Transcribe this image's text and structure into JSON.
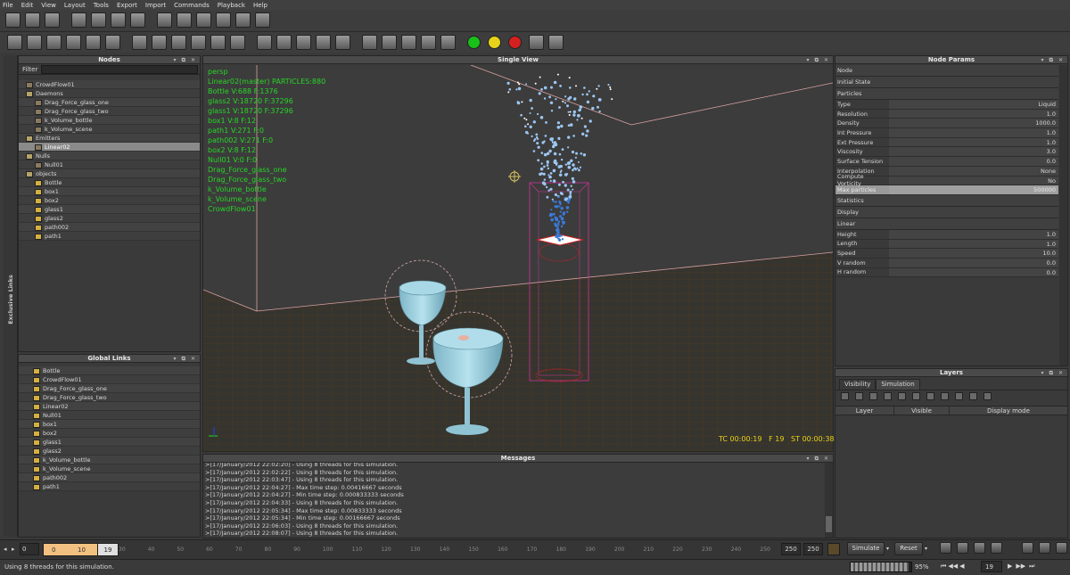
{
  "menu": [
    "File",
    "Edit",
    "View",
    "Layout",
    "Tools",
    "Export",
    "Import",
    "Commands",
    "Playback",
    "Help"
  ],
  "toolbar1_icons": [
    "new-scene-icon",
    "open-icon",
    "save-icon",
    "select-icon",
    "move-icon",
    "rotate-icon",
    "scale-icon",
    "box-node-icon",
    "cube-icon",
    "sphere-icon",
    "camera-icon",
    "field-icon",
    "grid-icon"
  ],
  "toolbar2_icons": [
    "daemon-icon",
    "emitter-icon",
    "null-icon",
    "volume-icon",
    "box-icon",
    "cylinder-icon",
    "link-icon",
    "select-link-icon",
    "rotate-link-icon",
    "flip-icon",
    "wire-icon",
    "plane-icon",
    "tube-icon",
    "gear-icon",
    "sphere-icon",
    "target-icon",
    "frame-icon",
    "frame2-icon",
    "shading-icon",
    "shading2-icon",
    "shading3-icon",
    "shading4-icon"
  ],
  "status_dots": {
    "green": "#18c018",
    "yellow": "#e6d21a",
    "red": "#d42020"
  },
  "nodes": {
    "title": "Nodes",
    "filter_label": "Filter",
    "items": [
      {
        "label": "CrowdFlow01",
        "indent": 1,
        "icon": "crowd-icon",
        "selected": false
      },
      {
        "label": "Daemons",
        "indent": 1,
        "icon": "folder-icon",
        "selected": false
      },
      {
        "label": "Drag_Force_glass_one",
        "indent": 2,
        "icon": "daemon-icon",
        "selected": false
      },
      {
        "label": "Drag_Force_glass_two",
        "indent": 2,
        "icon": "daemon-icon",
        "selected": false
      },
      {
        "label": "k_Volume_bottle",
        "indent": 2,
        "icon": "daemon-icon",
        "selected": false
      },
      {
        "label": "k_Volume_scene",
        "indent": 2,
        "icon": "daemon-icon",
        "selected": false
      },
      {
        "label": "Emitters",
        "indent": 1,
        "icon": "folder-icon",
        "selected": false
      },
      {
        "label": "Linear02",
        "indent": 2,
        "icon": "emitter-icon",
        "selected": true
      },
      {
        "label": "Nulls",
        "indent": 1,
        "icon": "folder-icon",
        "selected": false
      },
      {
        "label": "Null01",
        "indent": 2,
        "icon": "null-icon",
        "selected": false
      },
      {
        "label": "objects",
        "indent": 1,
        "icon": "folder-icon",
        "selected": false
      },
      {
        "label": "Bottle",
        "indent": 2,
        "icon": "object-icon",
        "selected": false
      },
      {
        "label": "box1",
        "indent": 2,
        "icon": "object-icon",
        "selected": false
      },
      {
        "label": "box2",
        "indent": 2,
        "icon": "object-icon",
        "selected": false
      },
      {
        "label": "glass1",
        "indent": 2,
        "icon": "object-icon",
        "selected": false
      },
      {
        "label": "glass2",
        "indent": 2,
        "icon": "object-icon",
        "selected": false
      },
      {
        "label": "path002",
        "indent": 2,
        "icon": "object-icon",
        "selected": false
      },
      {
        "label": "path1",
        "indent": 2,
        "icon": "object-icon",
        "selected": false
      }
    ]
  },
  "side_tab": "Exclusive Links",
  "global_links": {
    "title": "Global Links",
    "items": [
      "Bottle",
      "CrowdFlow01",
      "Drag_Force_glass_one",
      "Drag_Force_glass_two",
      "Linear02",
      "Null01",
      "box1",
      "box2",
      "glass1",
      "glass2",
      "k_Volume_bottle",
      "k_Volume_scene",
      "path002",
      "path1"
    ]
  },
  "viewport": {
    "title": "Single View",
    "overlay": [
      "persp",
      "Linear02(master) PARTICLES:880",
      "Bottle V:688 F:1376",
      "glass2 V:18720 F:37296",
      "glass1 V:18720 F:37296",
      "box1 V:8 F:12",
      "path1 V:271 F:0",
      "path002 V:271 F:0",
      "box2 V:8 F:12",
      "Null01 V:0 F:0",
      "Drag_Force_glass_one",
      "Drag_Force_glass_two",
      "k_Volume_bottle",
      "k_Volume_scene",
      "CrowdFlow01"
    ],
    "timecode": "TC 00:00:19   F 19   ST 00:00:38"
  },
  "messages": {
    "title": "Messages",
    "lines": [
      ">[17/January/2012 22:02:20] - Using 8 threads for this simulation.",
      ">[17/January/2012 22:02:22] - Using 8 threads for this simulation.",
      ">[17/January/2012 22:03:47] - Using 8 threads for this simulation.",
      ">[17/January/2012 22:04:27] - Max time step: 0.00416667 seconds",
      ">[17/January/2012 22:04:27] - Min time step: 0.000833333 seconds",
      ">[17/January/2012 22:04:33] - Using 8 threads for this simulation.",
      ">[17/January/2012 22:05:34] - Max time step: 0.00833333 seconds",
      ">[17/January/2012 22:05:34] - Min time step: 0.00166667 seconds",
      ">[17/January/2012 22:06:03] - Using 8 threads for this simulation.",
      ">[17/January/2012 22:08:07] - Using 8 threads for this simulation."
    ]
  },
  "node_params": {
    "title": "Node Params",
    "sections": [
      {
        "name": "Node",
        "rows": []
      },
      {
        "name": "Initial State",
        "rows": []
      },
      {
        "name": "Particles",
        "rows": [
          {
            "k": "Type",
            "v": "Liquid"
          },
          {
            "k": "Resolution",
            "v": "1.0"
          },
          {
            "k": "Density",
            "v": "1000.0"
          },
          {
            "k": "Int Pressure",
            "v": "1.0"
          },
          {
            "k": "Ext Pressure",
            "v": "1.0"
          },
          {
            "k": "Viscosity",
            "v": "3.0"
          },
          {
            "k": "Surface Tension",
            "v": "0.0"
          },
          {
            "k": "Interpolation",
            "v": "None"
          },
          {
            "k": "Compute Vorticity",
            "v": "No"
          },
          {
            "k": "Max particles",
            "v": "500000"
          }
        ]
      },
      {
        "name": "Statistics",
        "rows": []
      },
      {
        "name": "Display",
        "rows": []
      },
      {
        "name": "Linear",
        "rows": [
          {
            "k": "Height",
            "v": "1.0"
          },
          {
            "k": "Length",
            "v": "1.0"
          },
          {
            "k": "Speed",
            "v": "10.0"
          },
          {
            "k": "V random",
            "v": "0.0"
          },
          {
            "k": "H random",
            "v": "0.0"
          }
        ]
      }
    ]
  },
  "layers": {
    "title": "Layers",
    "tabs": [
      "Visibility",
      "Simulation"
    ],
    "columns": [
      "Layer",
      "Visible",
      "Display mode"
    ]
  },
  "timeline": {
    "start": "0",
    "range_start": "0",
    "range_end": "10",
    "current": "19",
    "ticks": [
      "30",
      "40",
      "50",
      "60",
      "70",
      "80",
      "90",
      "100",
      "110",
      "120",
      "130",
      "140",
      "150",
      "160",
      "170",
      "180",
      "190",
      "200",
      "210",
      "220",
      "230",
      "240",
      "250"
    ],
    "end_a": "250",
    "end_b": "250",
    "simulate_label": "Simulate",
    "reset_label": "Reset",
    "progress_percent": "95%",
    "progress_value": 0.95,
    "frame_field": "19"
  },
  "status": "Using 8 threads for this simulation."
}
